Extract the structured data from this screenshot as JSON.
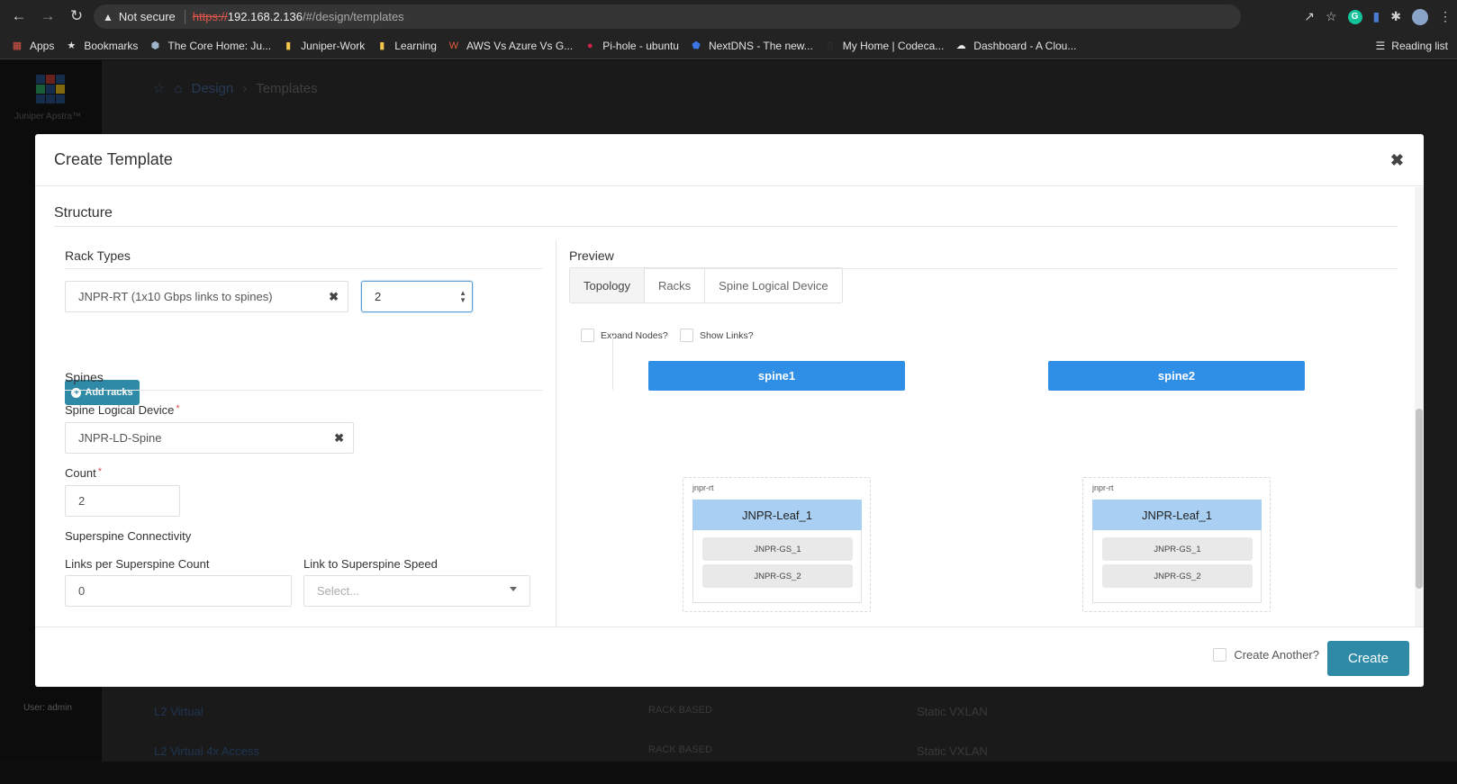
{
  "browser": {
    "not_secure": "Not secure",
    "url_scheme": "https://",
    "url_host": "192.168.2.136",
    "url_path": "/#/design/templates",
    "bookmarks": [
      {
        "label": "Apps",
        "icon": "apps-grid-icon"
      },
      {
        "label": "Bookmarks",
        "icon": "star-icon"
      },
      {
        "label": "The Core Home: Ju...",
        "icon": "shield-icon"
      },
      {
        "label": "Juniper-Work",
        "icon": "folder-icon"
      },
      {
        "label": "Learning",
        "icon": "folder-icon"
      },
      {
        "label": "AWS Vs Azure Vs G...",
        "icon": "site-icon"
      },
      {
        "label": "Pi-hole - ubuntu",
        "icon": "raspberry-icon"
      },
      {
        "label": "NextDNS - The new...",
        "icon": "shield-icon"
      },
      {
        "label": "My Home | Codeca...",
        "icon": "page-icon"
      },
      {
        "label": "Dashboard - A Clou...",
        "icon": "cloud-icon"
      }
    ],
    "reading_list": "Reading list"
  },
  "app": {
    "logo_text": "Juniper Apstra™",
    "breadcrumb": [
      "Design",
      "Templates"
    ],
    "user_label": "User: admin",
    "background_rows": [
      {
        "name": "L2 Virtual",
        "type": "RACK BASED",
        "overlay": "Static VXLAN"
      },
      {
        "name": "L2 Virtual 4x Access",
        "type": "RACK BASED",
        "overlay": "Static VXLAN"
      }
    ]
  },
  "modal": {
    "title": "Create Template",
    "section_title": "Structure",
    "rack_types": {
      "heading": "Rack Types",
      "selected": "JNPR-RT (1x10 Gbps links to spines)",
      "count": "2",
      "add_button": "Add racks"
    },
    "spines": {
      "heading": "Spines",
      "logical_device_label": "Spine Logical Device",
      "logical_device_value": "JNPR-LD-Spine",
      "count_label": "Count",
      "count_value": "2",
      "superspine_heading": "Superspine Connectivity",
      "links_label": "Links per Superspine Count",
      "links_value": "0",
      "speed_label": "Link to Superspine Speed",
      "speed_placeholder": "Select..."
    },
    "preview": {
      "heading": "Preview",
      "tabs": [
        "Topology",
        "Racks",
        "Spine Logical Device"
      ],
      "active_tab": "Topology",
      "expand_nodes": "Expand Nodes?",
      "show_links": "Show Links?",
      "spines": [
        "spine1",
        "spine2"
      ],
      "racks": [
        {
          "rack_name": "jnpr-rt",
          "leaf": "JNPR-Leaf_1",
          "generic_systems": [
            "JNPR-GS_1",
            "JNPR-GS_2"
          ]
        },
        {
          "rack_name": "jnpr-rt",
          "leaf": "JNPR-Leaf_1",
          "generic_systems": [
            "JNPR-GS_1",
            "JNPR-GS_2"
          ]
        }
      ]
    },
    "footer": {
      "create_another": "Create Another?",
      "create_button": "Create"
    }
  },
  "colors": {
    "primary_button": "#2f8aa7",
    "spine_node": "#2f8ee5",
    "leaf_node": "#a9d0f2",
    "required": "#d9534f"
  }
}
